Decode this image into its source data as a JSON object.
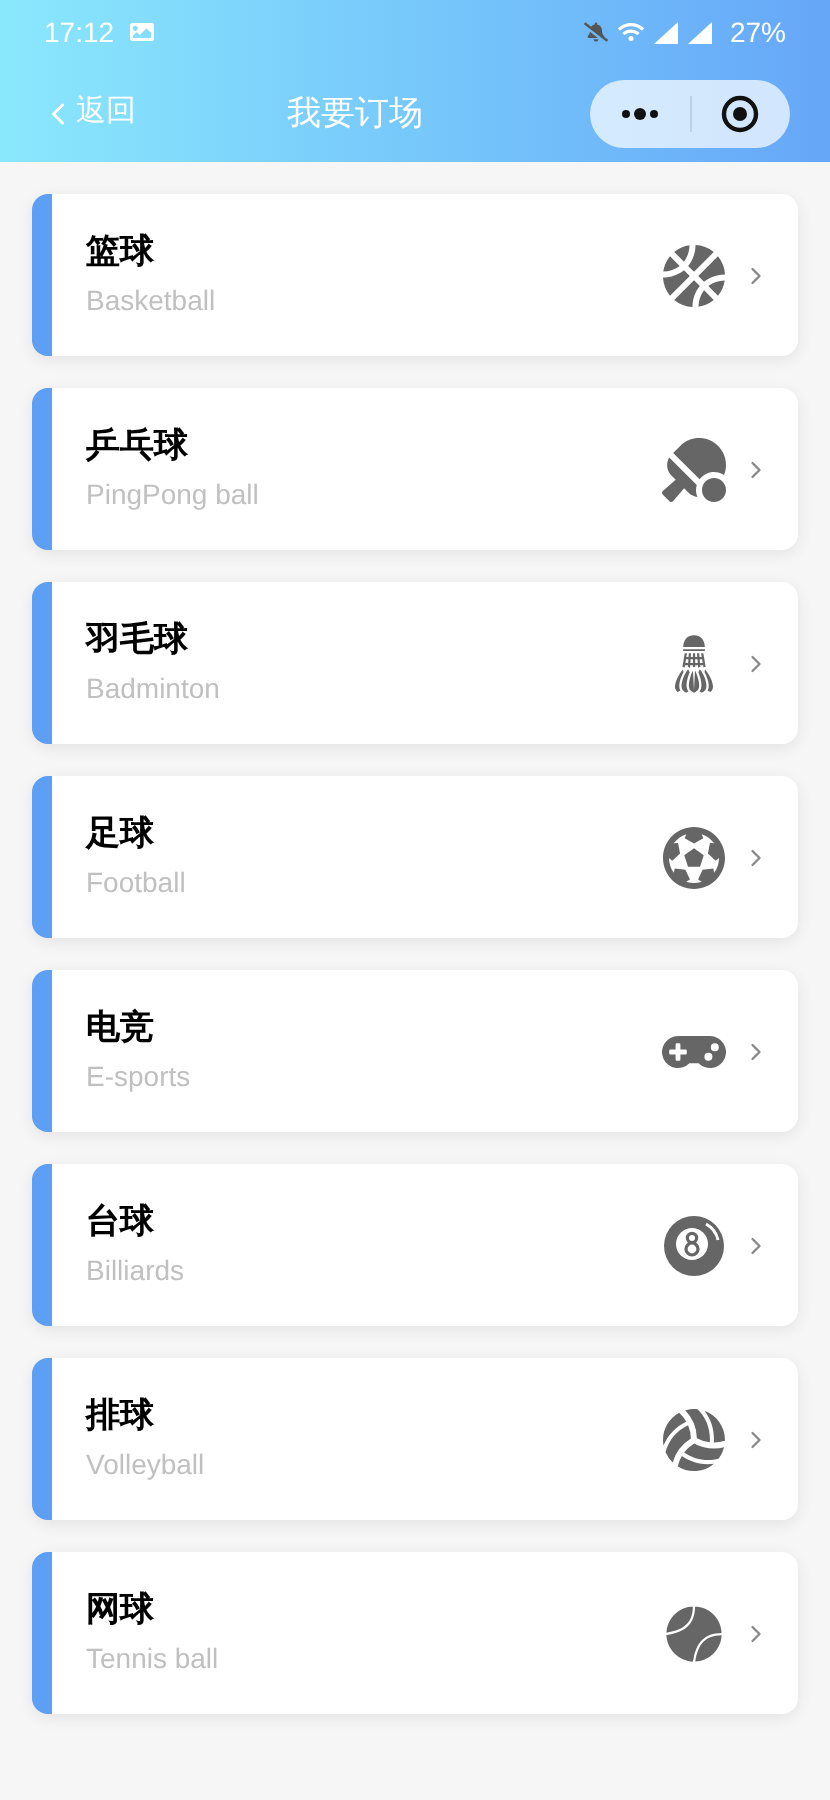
{
  "status_bar": {
    "time": "17:12",
    "battery": "27%"
  },
  "nav": {
    "back": "返回",
    "title": "我要订场"
  },
  "sports": [
    {
      "kind": "basketball",
      "name": "篮球",
      "english": "Basketball"
    },
    {
      "kind": "pingpong",
      "name": "乒乓球",
      "english": "PingPong ball"
    },
    {
      "kind": "badminton",
      "name": "羽毛球",
      "english": "Badminton"
    },
    {
      "kind": "football",
      "name": "足球",
      "english": "Football"
    },
    {
      "kind": "esports",
      "name": "电竞",
      "english": "E-sports"
    },
    {
      "kind": "billiards",
      "name": "台球",
      "english": "Billiards"
    },
    {
      "kind": "volleyball",
      "name": "排球",
      "english": "Volleyball"
    },
    {
      "kind": "tennis",
      "name": "网球",
      "english": "Tennis ball"
    }
  ]
}
